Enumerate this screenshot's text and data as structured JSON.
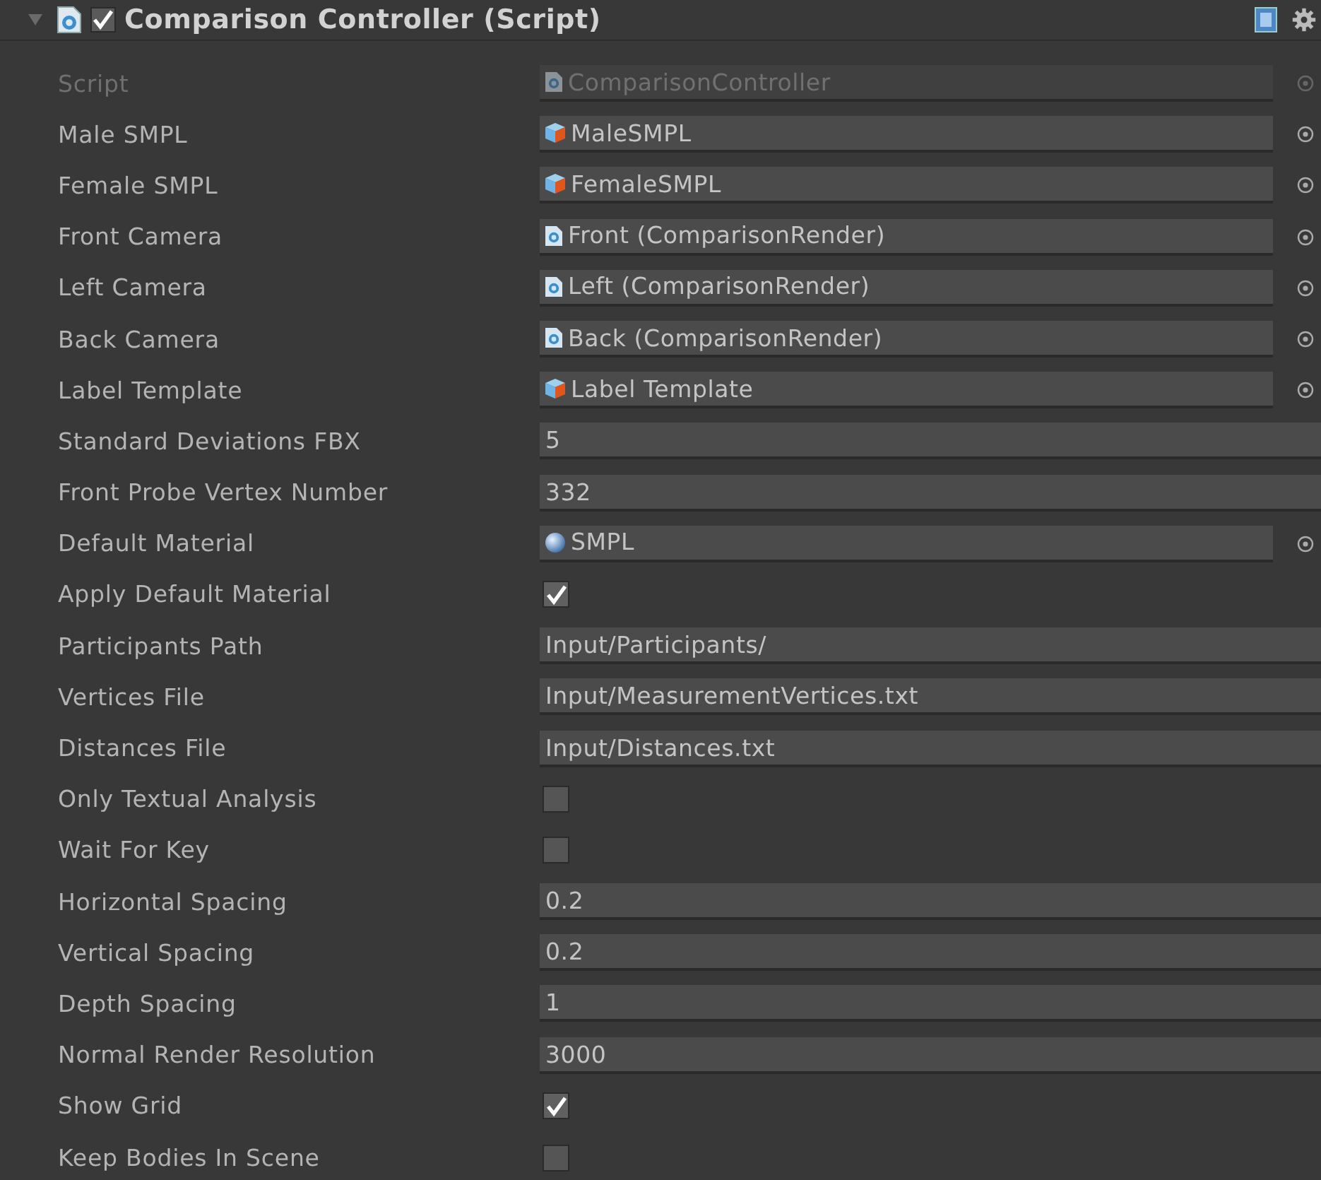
{
  "component": {
    "title": "Comparison Controller (Script)",
    "expanded": true,
    "enabled": true
  },
  "fields": [
    {
      "label": "Script",
      "kind": "script",
      "value": "ComparisonController",
      "disabled": true
    },
    {
      "label": "Male SMPL",
      "kind": "prefab",
      "value": "MaleSMPL",
      "disabled": false
    },
    {
      "label": "Female SMPL",
      "kind": "prefab",
      "value": "FemaleSMPL",
      "disabled": false
    },
    {
      "label": "Front Camera",
      "kind": "script",
      "value": "Front (ComparisonRender)",
      "disabled": false
    },
    {
      "label": "Left Camera",
      "kind": "script",
      "value": "Left (ComparisonRender)",
      "disabled": false
    },
    {
      "label": "Back Camera",
      "kind": "script",
      "value": "Back (ComparisonRender)",
      "disabled": false
    },
    {
      "label": "Label Template",
      "kind": "prefab",
      "value": "Label Template",
      "disabled": false
    },
    {
      "label": "Standard Deviations FBX",
      "kind": "text",
      "value": "5"
    },
    {
      "label": "Front Probe Vertex Number",
      "kind": "text",
      "value": "332"
    },
    {
      "label": "Default Material",
      "kind": "material",
      "value": "SMPL",
      "disabled": false
    },
    {
      "label": "Apply Default Material",
      "kind": "checkbox",
      "checked": true
    },
    {
      "label": "Participants Path",
      "kind": "text",
      "value": "Input/Participants/"
    },
    {
      "label": "Vertices File",
      "kind": "text",
      "value": "Input/MeasurementVertices.txt"
    },
    {
      "label": "Distances File",
      "kind": "text",
      "value": "Input/Distances.txt"
    },
    {
      "label": "Only Textual Analysis",
      "kind": "checkbox",
      "checked": false
    },
    {
      "label": "Wait For Key",
      "kind": "checkbox",
      "checked": false
    },
    {
      "label": "Horizontal Spacing",
      "kind": "text",
      "value": "0.2"
    },
    {
      "label": "Vertical Spacing",
      "kind": "text",
      "value": "0.2"
    },
    {
      "label": "Depth Spacing",
      "kind": "text",
      "value": "1"
    },
    {
      "label": "Normal Render Resolution",
      "kind": "text",
      "value": "3000"
    },
    {
      "label": "Show Grid",
      "kind": "checkbox",
      "checked": true
    },
    {
      "label": "Keep Bodies In Scene",
      "kind": "checkbox",
      "checked": false
    }
  ]
}
